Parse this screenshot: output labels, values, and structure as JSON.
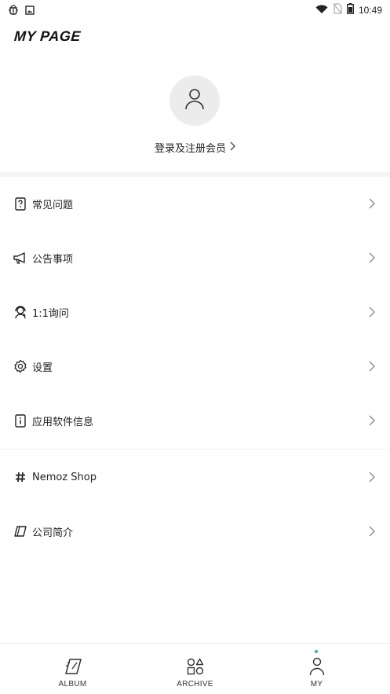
{
  "status_bar": {
    "time": "10:49",
    "left_icons": [
      "bug-icon",
      "image-icon"
    ],
    "right_icons": [
      "wifi-icon",
      "no-sim-icon",
      "battery-icon"
    ]
  },
  "header": {
    "title": "MY PAGE"
  },
  "profile": {
    "login_text": "登录及注册会员"
  },
  "menu_group1": [
    {
      "label": "常见问题",
      "icon": "faq-icon"
    },
    {
      "label": "公告事项",
      "icon": "megaphone-icon"
    },
    {
      "label": "1:1询问",
      "icon": "support-agent-icon"
    },
    {
      "label": "设置",
      "icon": "gear-icon"
    },
    {
      "label": "应用软件信息",
      "icon": "info-icon"
    }
  ],
  "menu_group2": [
    {
      "label": "Nemoz Shop",
      "icon": "hash-icon"
    },
    {
      "label": "公司简介",
      "icon": "company-icon"
    }
  ],
  "tab_bar": {
    "tabs": [
      {
        "label": "ALBUM",
        "icon": "album-icon"
      },
      {
        "label": "ARCHIVE",
        "icon": "archive-icon"
      },
      {
        "label": "MY",
        "icon": "person-icon",
        "active": true
      }
    ],
    "accent_color": "#28b8a8"
  }
}
